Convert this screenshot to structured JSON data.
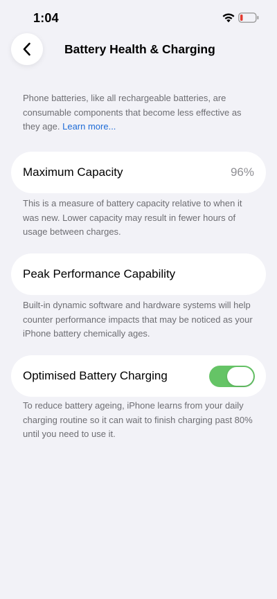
{
  "status_bar": {
    "time": "1:04",
    "battery_color": "#e23b30"
  },
  "nav": {
    "back_icon": "chevron-left-icon",
    "title": "Battery Health & Charging"
  },
  "intro": {
    "text": "Phone batteries, like all rechargeable batteries, are consumable components that become less effective as they age. ",
    "link": "Learn more..."
  },
  "max_capacity": {
    "label": "Maximum Capacity",
    "value": "96%",
    "note": "This is a measure of battery capacity relative to when it was new. Lower capacity may result in fewer hours of usage between charges."
  },
  "peak_performance": {
    "label": "Peak Performance Capability",
    "note": "Built-in dynamic software and hardware systems will help counter performance impacts that may be noticed as your iPhone battery chemically ages."
  },
  "optimised_charging": {
    "label": "Optimised Battery Charging",
    "enabled": true,
    "toggle_color": "#65c466",
    "note": "To reduce battery ageing, iPhone learns from your daily charging routine so it can wait to finish charging past 80% until you need to use it."
  }
}
